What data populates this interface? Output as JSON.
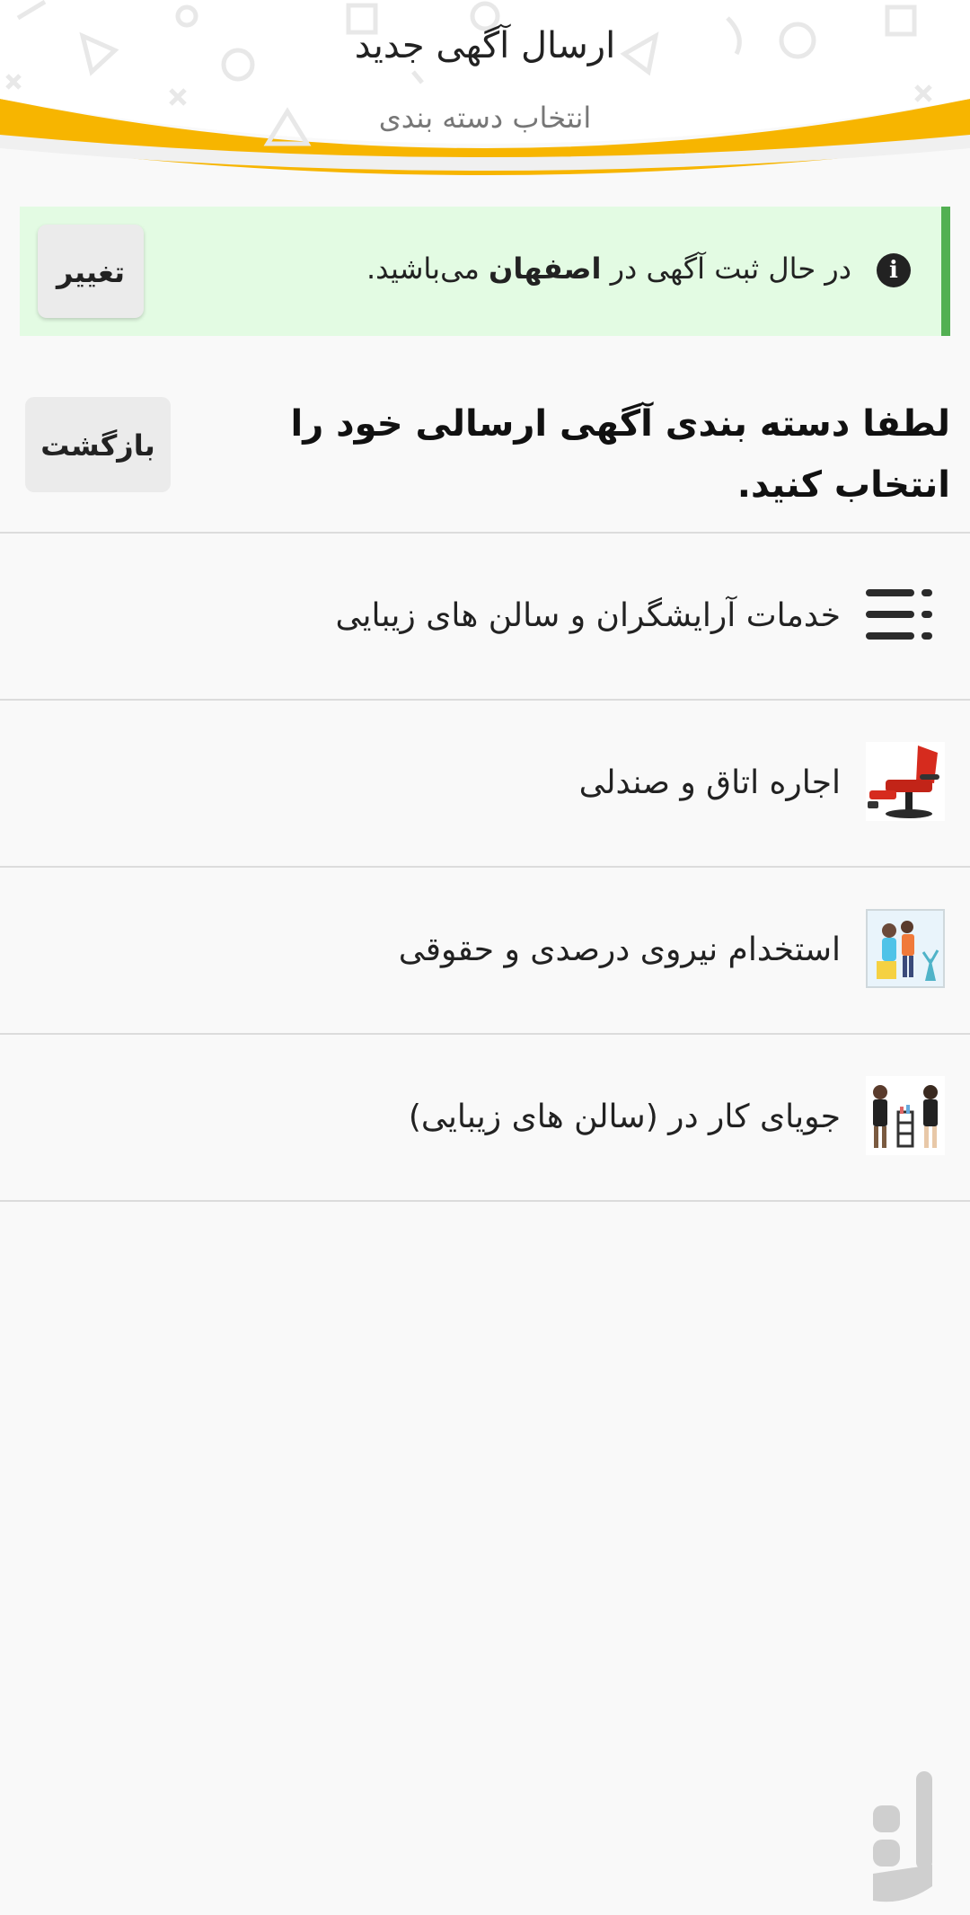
{
  "header": {
    "title": "ارسال آگهی جدید",
    "subtitle": "انتخاب دسته بندی",
    "accent_color": "#f7b500"
  },
  "location_banner": {
    "text_before": "در حال ثبت آگهی در ",
    "city": "اصفهان",
    "text_after": " می‌باشید.",
    "change_label": "تغییر",
    "background": "#e3fbe3",
    "border_color": "#52b052",
    "icon": "info-icon"
  },
  "instruction": {
    "text": "لطفا دسته بندی آگهی ارسالی خود را انتخاب کنید.",
    "back_label": "بازگشت"
  },
  "categories": [
    {
      "label": "خدمات آرایشگران و سالن های زیبایی",
      "icon": "list-icon"
    },
    {
      "label": "اجاره اتاق و صندلی",
      "icon": "barber-chair-image"
    },
    {
      "label": "استخدام نیروی درصدی و حقوقی",
      "icon": "hairdresser-staff-image"
    },
    {
      "label": "جویای کار در (سالن های زیبایی)",
      "icon": "salon-workers-image"
    }
  ],
  "watermark": {
    "icon": "store-logo-watermark"
  }
}
